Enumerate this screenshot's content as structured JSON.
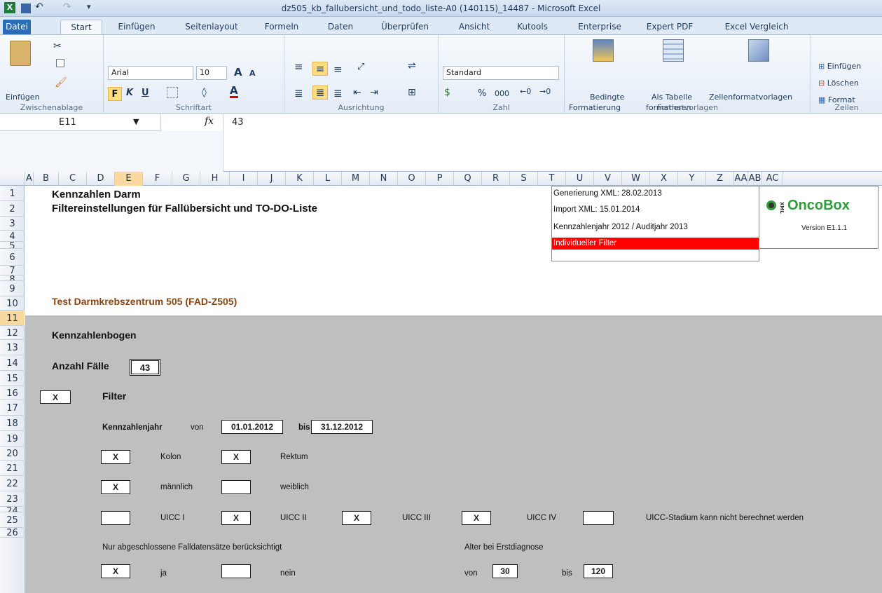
{
  "window": {
    "title": "dz505_kb_fallubersicht_und_todo_liste-A0 (140115)_14487  -  Microsoft Excel"
  },
  "ribbon_tabs": [
    "Datei",
    "Start",
    "Einfügen",
    "Seitenlayout",
    "Formeln",
    "Daten",
    "Überprüfen",
    "Ansicht",
    "Kutools",
    "Enterprise",
    "Expert PDF",
    "Excel Vergleich"
  ],
  "ribbon": {
    "clipboard": {
      "paste_label": "Einfügen",
      "group_label": "Zwischenablage"
    },
    "font": {
      "font_name": "Arial",
      "font_size": "10",
      "bold": "F",
      "italic": "K",
      "underline": "U",
      "group_label": "Schriftart"
    },
    "alignment": {
      "group_label": "Ausrichtung"
    },
    "number": {
      "format": "Standard",
      "percent": "%",
      "thousands": "000",
      "group_label": "Zahl"
    },
    "styles": {
      "conditional": "Bedingte",
      "conditional2": "Formatierung",
      "as_table": "Als Tabelle",
      "as_table2": "formatieren",
      "cell_styles": "Zellenformatvorlagen",
      "group_label": "Formatvorlagen"
    },
    "cells": {
      "insert": "Einfügen",
      "delete": "Löschen",
      "format": "Format",
      "group_label": "Zellen"
    }
  },
  "formula_bar": {
    "name_box": "E11",
    "fx": "fx",
    "value": "43"
  },
  "columns": [
    "A",
    "B",
    "C",
    "D",
    "E",
    "F",
    "G",
    "H",
    "I",
    "J",
    "K",
    "L",
    "M",
    "N",
    "O",
    "P",
    "Q",
    "R",
    "S",
    "T",
    "U",
    "V",
    "W",
    "X",
    "Y",
    "Z",
    "AA",
    "AB",
    "AC"
  ],
  "selected_column": "E",
  "rows": [
    "1",
    "2",
    "3",
    "4",
    "5",
    "6",
    "7",
    "8",
    "9",
    "10",
    "11",
    "12",
    "13",
    "14",
    "15",
    "16",
    "17",
    "18",
    "19",
    "20",
    "21",
    "22",
    "23",
    "24",
    "25",
    "26"
  ],
  "selected_row": "11",
  "sheet": {
    "title1": "Kennzahlen Darm",
    "title2": "Filtereinstellungen für Fallübersicht und TO-DO-Liste",
    "center": "Test Darmkrebszentrum 505 (FAD-Z505)",
    "info": {
      "gen": "Generierung XML: 28.02.2013",
      "imp": "Import XML: 15.01.2014",
      "year": "Kennzahlenjahr 2012 / Auditjahr 2013",
      "filter": "Individueller Filter"
    },
    "logo": {
      "prefix": "XML",
      "name": "OncoBox",
      "version": "Version E1.1.1"
    },
    "section": "Kennzahlenbogen",
    "anzahl_label": "Anzahl Fälle",
    "anzahl_value": "43",
    "filter_check": "X",
    "filter_label": "Filter",
    "kj_label": "Kennzahlenjahr",
    "von": "von",
    "bis": "bis",
    "date_from": "01.01.2012",
    "date_to": "31.12.2012",
    "kolon_check": "X",
    "kolon": "Kolon",
    "rektum_check": "X",
    "rektum": "Rektum",
    "m_check": "X",
    "maennlich": "männlich",
    "w_check": "",
    "weiblich": "weiblich",
    "uicc1_check": "",
    "uicc1": "UICC I",
    "uicc2_check": "X",
    "uicc2": "UICC II",
    "uicc3_check": "X",
    "uicc3": "UICC III",
    "uicc4_check": "X",
    "uicc4": "UICC IV",
    "uiccn_check": "",
    "uiccn": "UICC-Stadium kann nicht berechnet werden",
    "nur_label": "Nur abgeschlossene Falldatensätze berücksichtigt",
    "ja_check": "X",
    "ja": "ja",
    "nein_check": "",
    "nein": "nein",
    "alter_label": "Alter bei Erstdiagnose",
    "alter_von": "von",
    "alter_from": "30",
    "alter_bis": "bis",
    "alter_to": "120"
  },
  "colors": {
    "filter_red": "#ff0000",
    "sheet_gray": "#bfbfbf",
    "center_text": "#8b4513"
  }
}
